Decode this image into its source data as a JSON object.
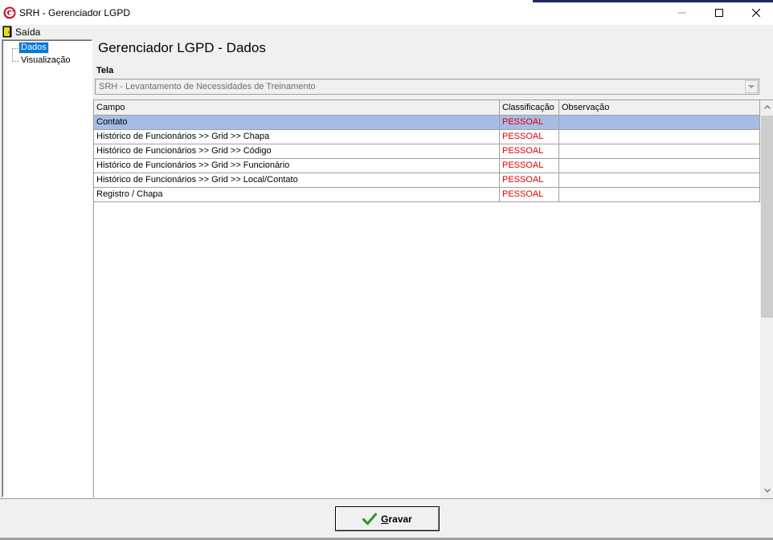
{
  "window": {
    "title": "SRH - Gerenciador LGPD"
  },
  "menu": {
    "exit_label": "Saída"
  },
  "tree": {
    "items": [
      {
        "label": "Dados",
        "selected": true
      },
      {
        "label": "Visualização",
        "selected": false
      }
    ]
  },
  "main": {
    "title": "Gerenciador LGPD - Dados",
    "tela_label": "Tela",
    "tela_value": "SRH - Levantamento de Necessidades de Treinamento"
  },
  "grid": {
    "columns": [
      "Campo",
      "Classificação",
      "Observação"
    ],
    "rows": [
      {
        "campo": "Contato",
        "classificacao": "PESSOAL",
        "observacao": ""
      },
      {
        "campo": "Histórico de Funcionários >> Grid >> Chapa",
        "classificacao": "PESSOAL",
        "observacao": ""
      },
      {
        "campo": "Histórico de Funcionários >> Grid >> Código",
        "classificacao": "PESSOAL",
        "observacao": ""
      },
      {
        "campo": "Histórico de Funcionários >> Grid >> Funcionário",
        "classificacao": "PESSOAL",
        "observacao": ""
      },
      {
        "campo": "Histórico de Funcionários >> Grid >> Local/Contato",
        "classificacao": "PESSOAL",
        "observacao": ""
      },
      {
        "campo": "Registro / Chapa",
        "classificacao": "PESSOAL",
        "observacao": ""
      }
    ]
  },
  "footer": {
    "save_label_underlined": "G",
    "save_label_rest": "ravar"
  },
  "colors": {
    "selection": "#0078d7",
    "row_selected": "#a6bce6",
    "classification_text": "#e00000",
    "app_icon": "#c8102e",
    "save_check": "#2a9d2a"
  }
}
